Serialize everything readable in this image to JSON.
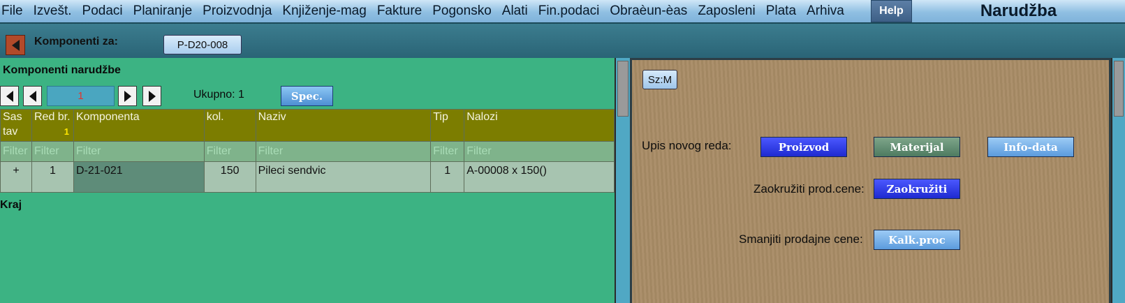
{
  "menu": {
    "items": [
      "File",
      "Izvešt.",
      "Podaci",
      "Planiranje",
      "Proizvodnja",
      "Knjiženje-mag",
      "Fakture",
      "Pogonsko",
      "Alati",
      "Fin.podaci",
      "Obraèun-èas",
      "Zaposleni",
      "Plata",
      "Arhiva"
    ],
    "help": "Help",
    "title": "Narudžba"
  },
  "subbar": {
    "label": "Komponenti za:",
    "value": "P-D20-008"
  },
  "left": {
    "title": "Komponenti narudžbe",
    "page": "1",
    "total": "Ukupno: 1",
    "spec": "Spec.",
    "footer": "Kraj",
    "columns": [
      {
        "label": "Sas tav"
      },
      {
        "label": "Red br.",
        "badge": "1"
      },
      {
        "label": "Komponenta"
      },
      {
        "label": "kol."
      },
      {
        "label": "Naziv"
      },
      {
        "label": "Tip"
      },
      {
        "label": "Nalozi"
      }
    ],
    "filter": "Filter",
    "rows": [
      {
        "sastav": "+",
        "red": "1",
        "komponenta": "D-21-021",
        "kol": "150",
        "naziv": "Pileci sendvic",
        "tip": "1",
        "nalozi": "A-00008 x 150()"
      }
    ]
  },
  "right": {
    "szm": "Sz:M",
    "new_row_label": "Upis novog reda:",
    "btn_proizvod": "Proizvod",
    "btn_materijal": "Materijal",
    "btn_infodata": "Info-data",
    "round_label": "Zaokružiti prod.cene:",
    "btn_round": "Zaokružiti",
    "reduce_label": "Smanjiti prodajne cene:",
    "btn_kalk": "Kalk.proc"
  }
}
